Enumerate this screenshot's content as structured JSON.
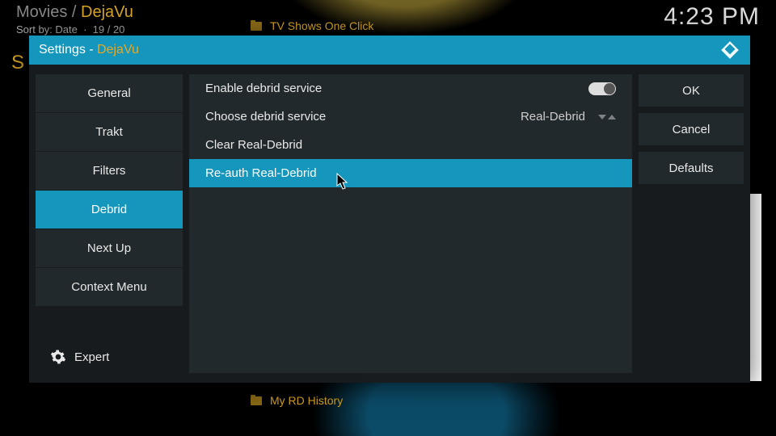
{
  "background": {
    "breadcrumb_root": "Movies",
    "breadcrumb_sep": " / ",
    "breadcrumb_leaf": "DejaVu",
    "sort_label": "Sort by: Date",
    "sort_count": "19 / 20",
    "clock": "4:23 PM",
    "letter": "S",
    "top_item": "TV Shows One Click",
    "bottom_item": "My RD History"
  },
  "dialog": {
    "title_prefix": "Settings - ",
    "title_name": "DejaVu",
    "sidebar": [
      {
        "label": "General",
        "selected": false
      },
      {
        "label": "Trakt",
        "selected": false
      },
      {
        "label": "Filters",
        "selected": false
      },
      {
        "label": "Debrid",
        "selected": true
      },
      {
        "label": "Next Up",
        "selected": false
      },
      {
        "label": "Context Menu",
        "selected": false
      }
    ],
    "expert_label": "Expert",
    "rows": [
      {
        "label": "Enable debrid service",
        "type": "toggle",
        "value": true,
        "selected": false
      },
      {
        "label": "Choose debrid service",
        "type": "select",
        "value": "Real-Debrid",
        "selected": false
      },
      {
        "label": "Clear Real-Debrid",
        "type": "action",
        "selected": false
      },
      {
        "label": "Re-auth Real-Debrid",
        "type": "action",
        "selected": true
      }
    ],
    "buttons": {
      "ok": "OK",
      "cancel": "Cancel",
      "defaults": "Defaults"
    }
  }
}
